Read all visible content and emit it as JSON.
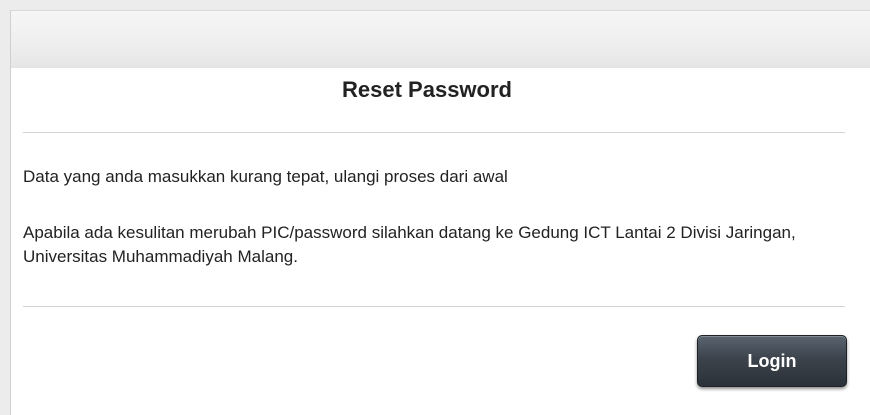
{
  "reset": {
    "title": "Reset Password",
    "message_1": "Data yang anda masukkan kurang tepat, ulangi proses dari awal",
    "message_2": "Apabila ada kesulitan merubah PIC/password silahkan datang ke Gedung ICT Lantai 2 Divisi Jaringan, Universitas Muhammadiyah Malang.",
    "login_label": "Login"
  },
  "colors": {
    "button_dark": "#2b3138",
    "text": "#222222",
    "background": "#ececec"
  }
}
